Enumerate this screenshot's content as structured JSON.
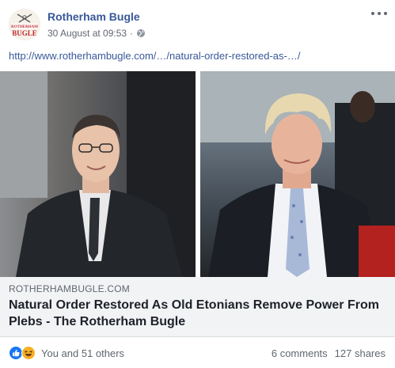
{
  "post": {
    "page_name": "Rotherham Bugle",
    "timestamp": "30 August at 09:53",
    "separator": "·",
    "audience_icon": "globe-icon",
    "more_icon": "ellipsis-icon",
    "link_url": "http://www.rotherhambugle.com/…/natural-order-restored-as-…/"
  },
  "avatar": {
    "logo_line1": "THE",
    "logo_line2": "ROTHERHAM",
    "logo_line3": "BUGLE"
  },
  "link_card": {
    "domain": "ROTHERHAMBUGLE.COM",
    "title": "Natural Order Restored As Old Etonians Remove Power From Plebs - The Rotherham Bugle"
  },
  "reactions": {
    "icons": [
      "like-icon",
      "haha-icon"
    ],
    "summary": "You and 51 others",
    "comments": "6 comments",
    "shares": "127 shares"
  },
  "colors": {
    "link_blue": "#385898",
    "meta_gray": "#606770",
    "like_blue": "#1877f2",
    "haha_yellow": "#f7b125",
    "logo_red": "#c0272d"
  }
}
